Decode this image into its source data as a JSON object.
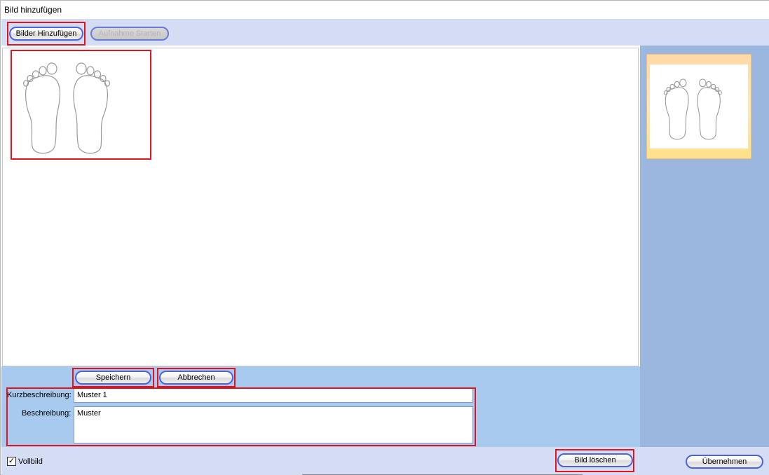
{
  "window": {
    "title": "Bild hinzufügen"
  },
  "toolbar": {
    "add_images_label": "Bilder Hinzufügen",
    "start_capture_label": "Aufnahme Starten"
  },
  "canvas": {
    "image_alt": "Fußabdrücke"
  },
  "edit": {
    "save_label": "Speichern",
    "cancel_label": "Abbrechen",
    "short_desc_label": "Kurzbeschreibung:",
    "short_desc_value": "Muster 1",
    "desc_label": "Beschreibung:",
    "desc_value": "Muster"
  },
  "footer": {
    "fullscreen_label": "Vollbild",
    "fullscreen_checked": true,
    "delete_image_label": "Bild löschen",
    "apply_label": "Übernehmen"
  },
  "icons": {
    "checkmark": "check-icon",
    "feet": "footprints-icon"
  },
  "colors": {
    "toolbar_bg": "#d5ddf4",
    "side_panel_bg": "#9bb7df",
    "edit_panel_bg": "#a7caee",
    "button_border": "#4c63e0",
    "highlight_red": "#e0141e",
    "thumb_bg": "#ffe0a0"
  }
}
